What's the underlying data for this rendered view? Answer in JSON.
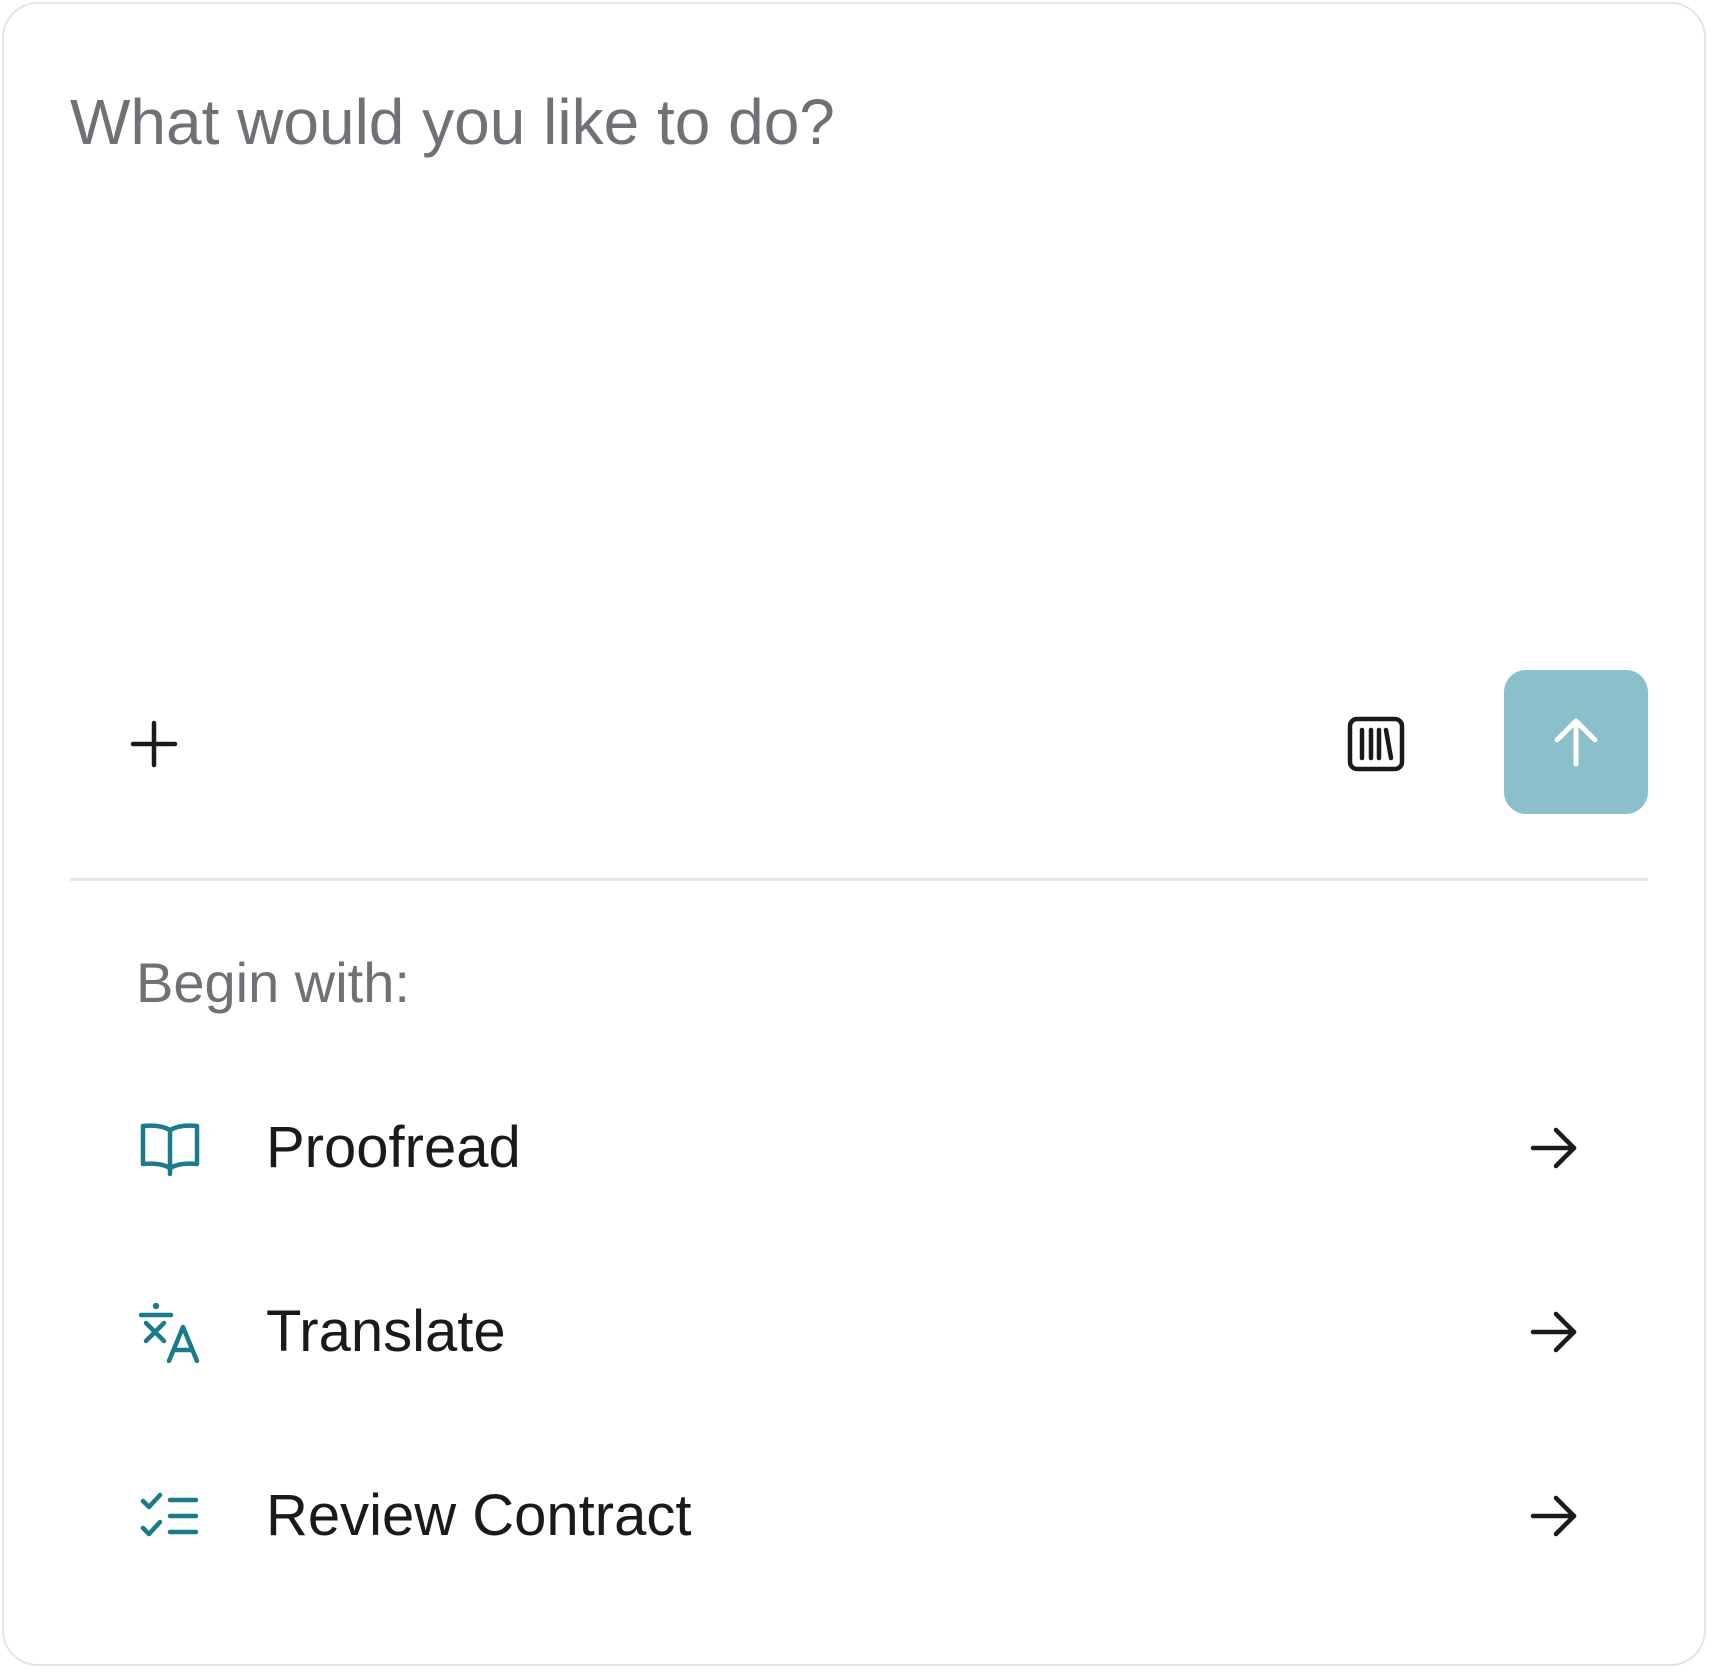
{
  "composer": {
    "placeholder": "What would you like to do?",
    "value": ""
  },
  "toolbar": {
    "add_icon": "plus-icon",
    "library_icon": "library-icon",
    "send_icon": "arrow-up-icon",
    "send_button_color": "#8bbfc9"
  },
  "suggestions": {
    "heading": "Begin with:",
    "accent_color": "#1b7a8c",
    "items": [
      {
        "label": "Proofread",
        "icon": "open-book-icon"
      },
      {
        "label": "Translate",
        "icon": "translate-icon"
      },
      {
        "label": "Review Contract",
        "icon": "checklist-icon"
      }
    ]
  }
}
